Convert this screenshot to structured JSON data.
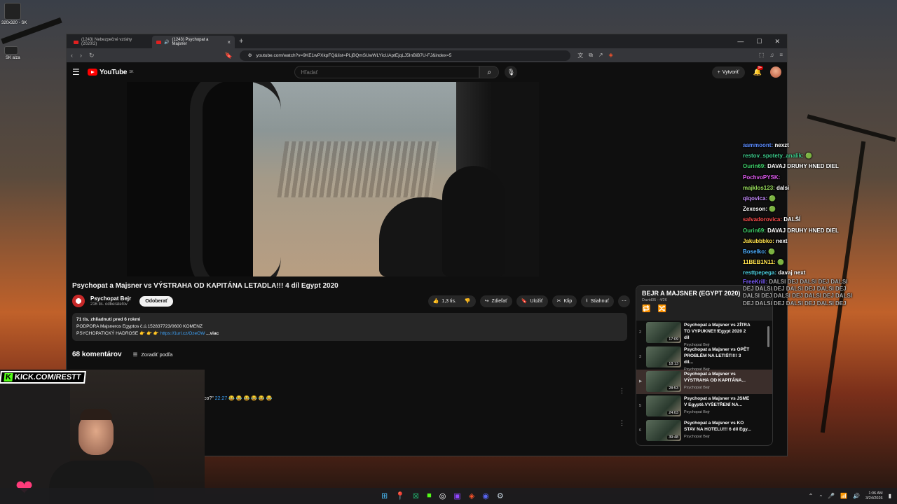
{
  "desktop": {
    "icon1_label": "320x320 - SK",
    "icon2_label": "SK alza"
  },
  "browser": {
    "tabs": [
      {
        "label": "(1243) Nebezpečné vzťahy (2020/2)",
        "active": false
      },
      {
        "label": "(1243) Psychopat a Majsner",
        "active": true
      }
    ],
    "url": "youtube.com/watch?v=9KE1wPXkpFQ&list=PLjBQmSUwWLYicUAptEjqLJ5InBiB7U-FJ&index=5"
  },
  "youtube": {
    "logo_text": "YouTube",
    "logo_region": "SK",
    "search_placeholder": "Hľadať",
    "create_label": "Vytvoriť",
    "notification_badge": "9+"
  },
  "video": {
    "title": "Psychopat a Majsner vs VÝSTRAHA OD KAPITÁNA LETADLA!!! 4 díl Egypt 2020",
    "channel": "Psychopat Bejr",
    "subscribers": "216 tis. odberateľov",
    "subscribe_label": "Odoberať",
    "actions": {
      "like": "1,3 tis.",
      "share": "Zdieľať",
      "save": "Uložiť",
      "clip": "Klip",
      "download": "Stiahnuť"
    },
    "description": {
      "stats": "71 tis. zhliadnutí  pred 6 rokmi",
      "line1": "PODPORA Majsneros  Egyptos  č.ú.152837723/0600 KOMENZ",
      "line2_prefix": "PSYCHOPATICKÝ HADROSE 👉 👉 👉 ",
      "link": "https://1url.cz/OzeOW",
      "more": " ...viac"
    },
    "comments_count": "68 komentárov",
    "sort_label": "Zoradiť podľa",
    "comment_snippet": {
      "text": "co?\" ",
      "timestamp": "22:27",
      "emojis": " 😂 😂 😂 😂 😂 😂"
    }
  },
  "playlist": {
    "title": "BEJR A MAJSNER (EGYPT 2020)",
    "meta": "David35 - 4/26",
    "items": [
      {
        "index": "2",
        "title": "Psychopat a Majsner vs ZÍTRA TO VYPUKNE!!!Egypt 2020 2 díl",
        "channel": "Psychopat Bejr",
        "duration": "17:09"
      },
      {
        "index": "3",
        "title": "Psychopat a Majsner vs OPĚT PROBLÉM NA LETIŠTI!!! 3 díl...",
        "channel": "Psychopat Bejr",
        "duration": "18:13"
      },
      {
        "index": "▶",
        "title": "Psychopat a Majsner vs VÝSTRAHA OD KAPITÁNA...",
        "channel": "Psychopat Bejr",
        "duration": "28:53"
      },
      {
        "index": "5",
        "title": "Psychopat a Majsner vs JSME V Egyptě.VYŠETŘENÍ NA...",
        "channel": "Psychopat Bejr",
        "duration": "24:03"
      },
      {
        "index": "6",
        "title": "Psychopat a Majsner vs KO STAV NA HOTELU!!! 6 díl Egy...",
        "channel": "Psychopat Bejr",
        "duration": "39:48"
      }
    ]
  },
  "chat": [
    {
      "user": "aammoont:",
      "text": "nexzt",
      "color": "#5b8cff"
    },
    {
      "user": "restov_spotety_analik:",
      "text": "🟢",
      "color": "#3ecf8e"
    },
    {
      "user": "Ourin69:",
      "text": "DAVAJ DRUHY HNED DIEL",
      "color": "#3fd16a"
    },
    {
      "user": "PochvoPYSK:",
      "text": "",
      "color": "#e05bf0"
    },
    {
      "user": "majklos123:",
      "text": "dalsi",
      "color": "#9be15d"
    },
    {
      "user": "qiqovica:",
      "text": "🟢",
      "color": "#c78bff"
    },
    {
      "user": "Zexeson:",
      "text": "🟢",
      "color": "#ffffff"
    },
    {
      "user": "salvadorovica:",
      "text": "DALŠÍ",
      "color": "#ff4d4d"
    },
    {
      "user": "Ourin69:",
      "text": "DAVAJ DRUHY HNED DIEL",
      "color": "#3fd16a"
    },
    {
      "user": "Jakubbbko:",
      "text": "next",
      "color": "#ffe14d"
    },
    {
      "user": "Boselko:",
      "text": "🟢",
      "color": "#4dafff"
    },
    {
      "user": "11BEB1N11:",
      "text": "🟢",
      "color": "#ffe14d"
    },
    {
      "user": "resttpepega:",
      "text": "davaj next",
      "color": "#4dd0e1"
    },
    {
      "user": "FreeKrill:",
      "text": "DALSI DEJ DALSI DEJ DALSI DEJ DALSI DEJ DALSI DEJ DALSI DEJ DALSI DEJ DALSI DEJ DALSI DEJ DALSI DEJ DALSI DEJ DALSI DEJ DALSI DEJ",
      "color": "#7c5cff"
    }
  ],
  "overlay": {
    "kick_label": "KICK.COM/RESTT"
  },
  "taskbar": {
    "time": "1:06 AM",
    "date": "3/24/2026"
  }
}
